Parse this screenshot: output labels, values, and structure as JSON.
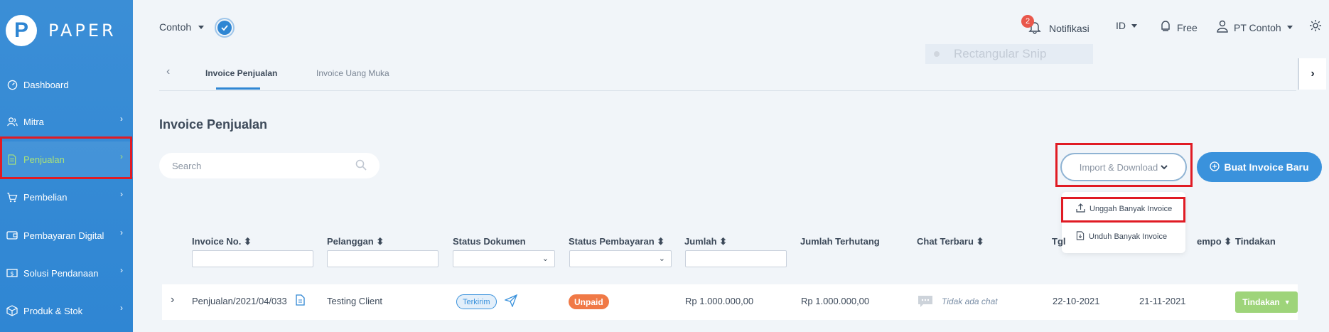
{
  "brand": {
    "logo_letter": "P",
    "name": "PAPER"
  },
  "sidebar": {
    "items": [
      {
        "label": "Dashboard",
        "icon": "dashboard-icon",
        "has_chevron": false
      },
      {
        "label": "Mitra",
        "icon": "users-icon",
        "has_chevron": true
      },
      {
        "label": "Penjualan",
        "icon": "document-icon",
        "has_chevron": true,
        "active": true
      },
      {
        "label": "Pembelian",
        "icon": "cart-icon",
        "has_chevron": true
      },
      {
        "label": "Pembayaran Digital",
        "icon": "wallet-icon",
        "has_chevron": true
      },
      {
        "label": "Solusi Pendanaan",
        "icon": "finance-icon",
        "has_chevron": true
      },
      {
        "label": "Produk & Stok",
        "icon": "box-icon",
        "has_chevron": true
      }
    ]
  },
  "header": {
    "company": "Contoh",
    "notification_count": "2",
    "notifications_label": "Notifikasi",
    "language": "ID",
    "plan": "Free",
    "account": "PT Contoh",
    "overlay_text": "Rectangular Snip"
  },
  "tabs": {
    "items": [
      {
        "label": "Invoice Penjualan",
        "active": true
      },
      {
        "label": "Invoice Uang Muka",
        "active": false
      }
    ]
  },
  "main": {
    "title": "Invoice Penjualan",
    "search_placeholder": "Search",
    "import_download_label": "Import & Download",
    "new_invoice_label": "Buat Invoice Baru",
    "dropdown": {
      "upload_label": "Unggah Banyak Invoice",
      "download_label": "Unduh Banyak Invoice"
    }
  },
  "table": {
    "headers": {
      "invoice_no": "Invoice No.",
      "customer": "Pelanggan",
      "doc_status": "Status Dokumen",
      "payment_status": "Status Pembayaran",
      "amount": "Jumlah",
      "outstanding": "Jumlah Terhutang",
      "last_chat": "Chat Terbaru",
      "date": "Tgl",
      "due": "empo",
      "action": "Tindakan"
    },
    "rows": [
      {
        "invoice_no": "Penjualan/2021/04/033",
        "customer": "Testing Client",
        "doc_status": "Terkirim",
        "payment_status": "Unpaid",
        "amount": "Rp 1.000.000,00",
        "outstanding": "Rp 1.000.000,00",
        "last_chat": "Tidak ada chat",
        "date": "22-10-2021",
        "due": "21-11-2021",
        "action": "Tindakan"
      }
    ]
  },
  "colors": {
    "sidebar": "#3b8ed6",
    "primary": "#3a92dc",
    "active_nav": "#a8e27a",
    "unpaid": "#f07946",
    "action": "#9ed47a",
    "highlight_box": "#e01b24"
  }
}
